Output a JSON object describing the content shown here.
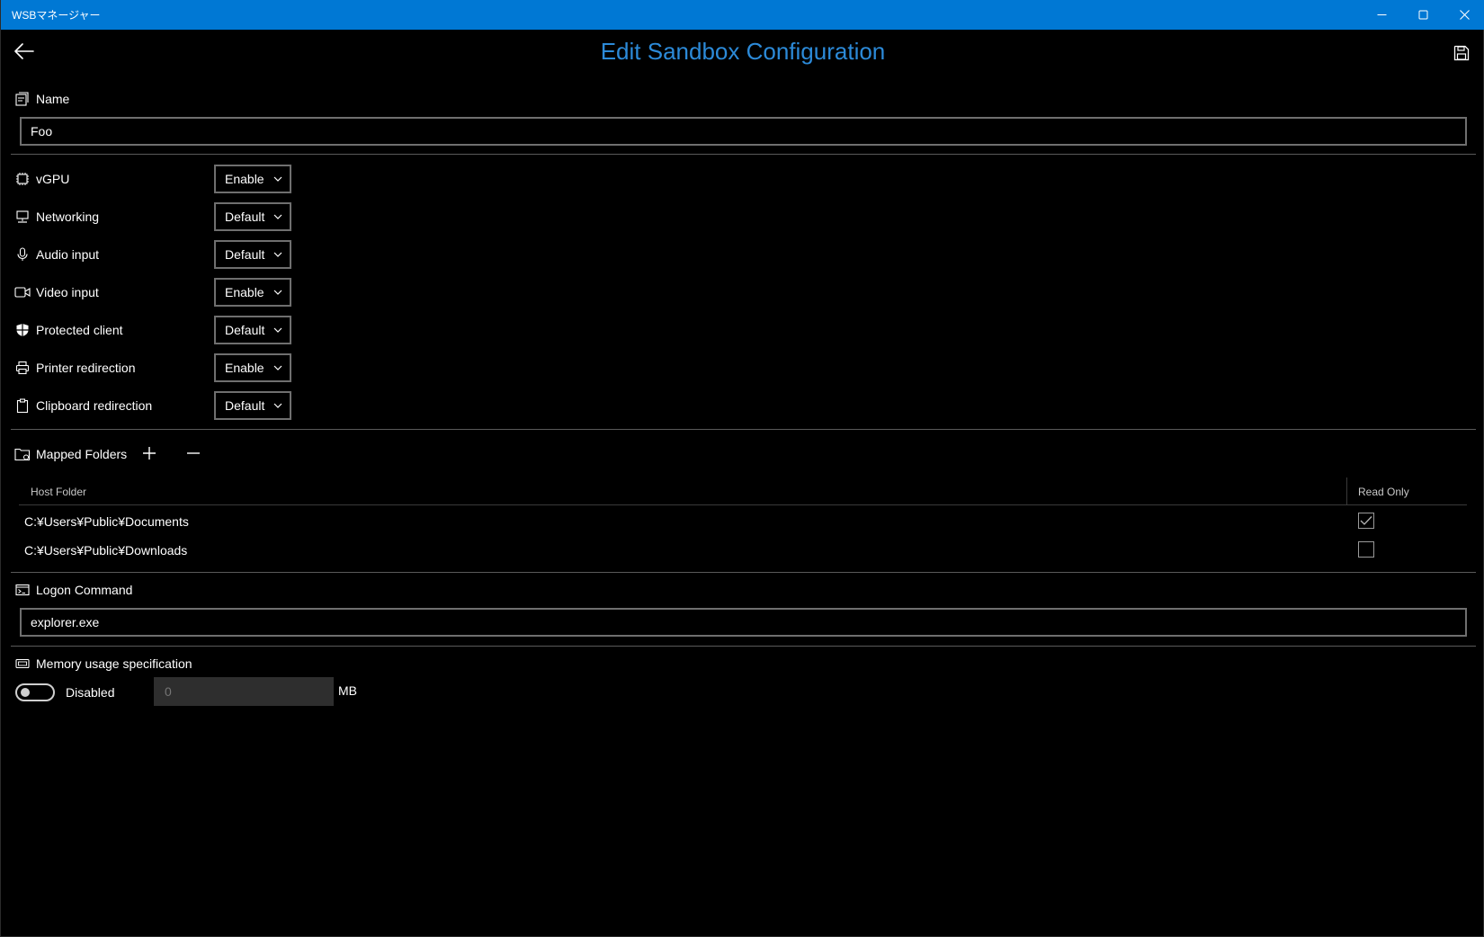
{
  "window": {
    "title": "WSBマネージャー"
  },
  "header": {
    "title": "Edit Sandbox Configuration",
    "title_color": "#2c8ad8"
  },
  "name": {
    "label": "Name",
    "value": "Foo"
  },
  "options": [
    {
      "label": "vGPU",
      "value": "Enable",
      "icon": "chip-icon"
    },
    {
      "label": "Networking",
      "value": "Default",
      "icon": "network-icon"
    },
    {
      "label": "Audio input",
      "value": "Default",
      "icon": "microphone-icon"
    },
    {
      "label": "Video input",
      "value": "Enable",
      "icon": "camera-icon"
    },
    {
      "label": "Protected client",
      "value": "Default",
      "icon": "shield-icon"
    },
    {
      "label": "Printer redirection",
      "value": "Enable",
      "icon": "printer-icon"
    },
    {
      "label": "Clipboard redirection",
      "value": "Default",
      "icon": "clipboard-icon"
    }
  ],
  "mapped_folders": {
    "label": "Mapped Folders",
    "columns": [
      "Host Folder",
      "Read Only"
    ],
    "rows": [
      {
        "host_folder": "C:¥Users¥Public¥Documents",
        "read_only": true
      },
      {
        "host_folder": "C:¥Users¥Public¥Downloads",
        "read_only": false
      }
    ]
  },
  "logon_command": {
    "label": "Logon Command",
    "value": "explorer.exe"
  },
  "memory": {
    "label": "Memory usage specification",
    "toggle_label": "Disabled",
    "toggle_on": false,
    "value": "0",
    "unit": "MB"
  },
  "colors": {
    "titlebar": "#0078d4",
    "background": "#000000"
  }
}
